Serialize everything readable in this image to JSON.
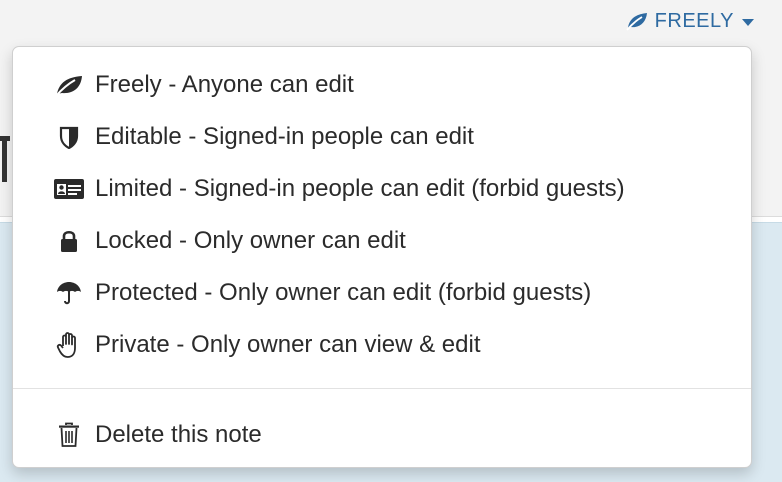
{
  "trigger": {
    "label": "FREELY",
    "icon": "leaf-icon",
    "color": "#2e6aa1"
  },
  "menu": {
    "items": [
      {
        "label": "Freely - Anyone can edit",
        "icon": "leaf-icon"
      },
      {
        "label": "Editable - Signed-in people can edit",
        "icon": "shield-icon"
      },
      {
        "label": "Limited - Signed-in people can edit (forbid guests)",
        "icon": "id-card-icon"
      },
      {
        "label": "Locked - Only owner can edit",
        "icon": "lock-icon"
      },
      {
        "label": "Protected - Only owner can edit (forbid guests)",
        "icon": "umbrella-icon"
      },
      {
        "label": "Private - Only owner can view & edit",
        "icon": "hand-icon"
      }
    ],
    "delete": {
      "label": "Delete this note",
      "icon": "trash-icon"
    }
  }
}
